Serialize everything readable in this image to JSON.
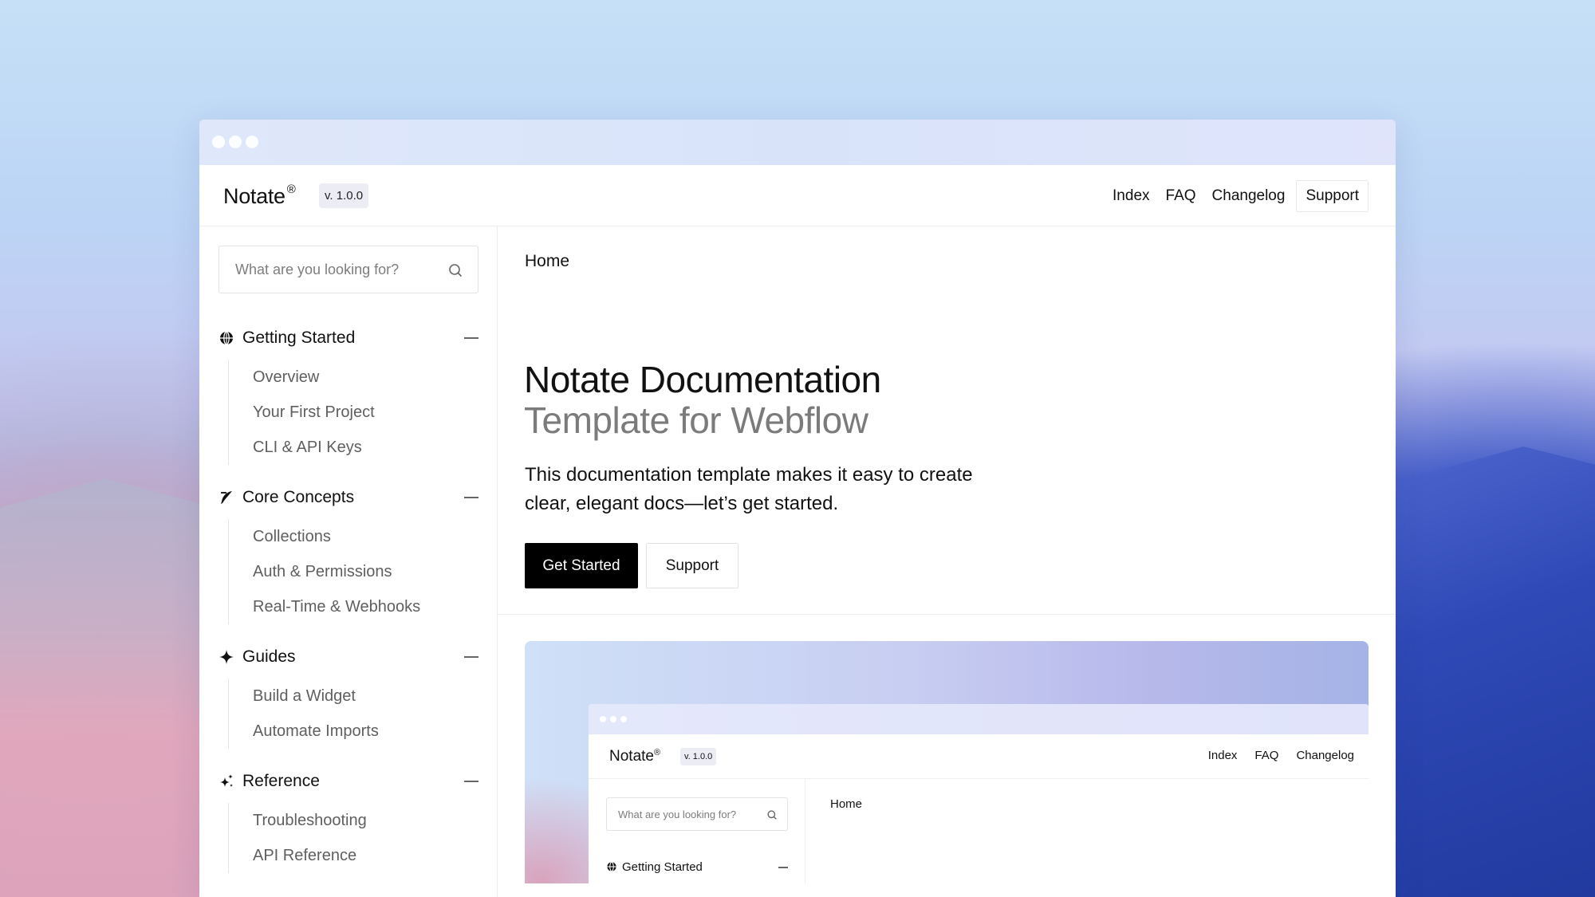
{
  "window": {
    "brand": "Notate",
    "brand_mark": "®",
    "version": "v. 1.0.0"
  },
  "nav": {
    "links": [
      "Index",
      "FAQ",
      "Changelog"
    ],
    "support": "Support"
  },
  "sidebar": {
    "search_placeholder": "What are you looking for?",
    "sections": [
      {
        "title": "Getting Started",
        "icon": "globe-icon",
        "items": [
          "Overview",
          "Your First Project",
          "CLI & API Keys"
        ]
      },
      {
        "title": "Core Concepts",
        "icon": "quill-icon",
        "items": [
          "Collections",
          "Auth & Permissions",
          "Real-Time & Webhooks"
        ]
      },
      {
        "title": "Guides",
        "icon": "sparkle-icon",
        "items": [
          "Build a Widget",
          "Automate Imports"
        ]
      },
      {
        "title": "Reference",
        "icon": "sparkles-icon",
        "items": [
          "Troubleshooting",
          "API Reference"
        ]
      }
    ]
  },
  "main": {
    "breadcrumb": "Home",
    "title": "Notate Documentation",
    "subtitle": "Template for Webflow",
    "description": "This documentation template makes it easy to create clear, elegant docs—let’s get started.",
    "primary_button": "Get Started",
    "secondary_button": "Support"
  },
  "preview": {
    "brand": "Notate",
    "brand_mark": "®",
    "version": "v. 1.0.0",
    "links": [
      "Index",
      "FAQ",
      "Changelog"
    ],
    "search_placeholder": "What are you looking for?",
    "section_title": "Getting Started",
    "breadcrumb": "Home"
  },
  "colors": {
    "accent": "#000000",
    "muted_text": "#7b7b7b",
    "badge_bg": "#ececf5"
  }
}
